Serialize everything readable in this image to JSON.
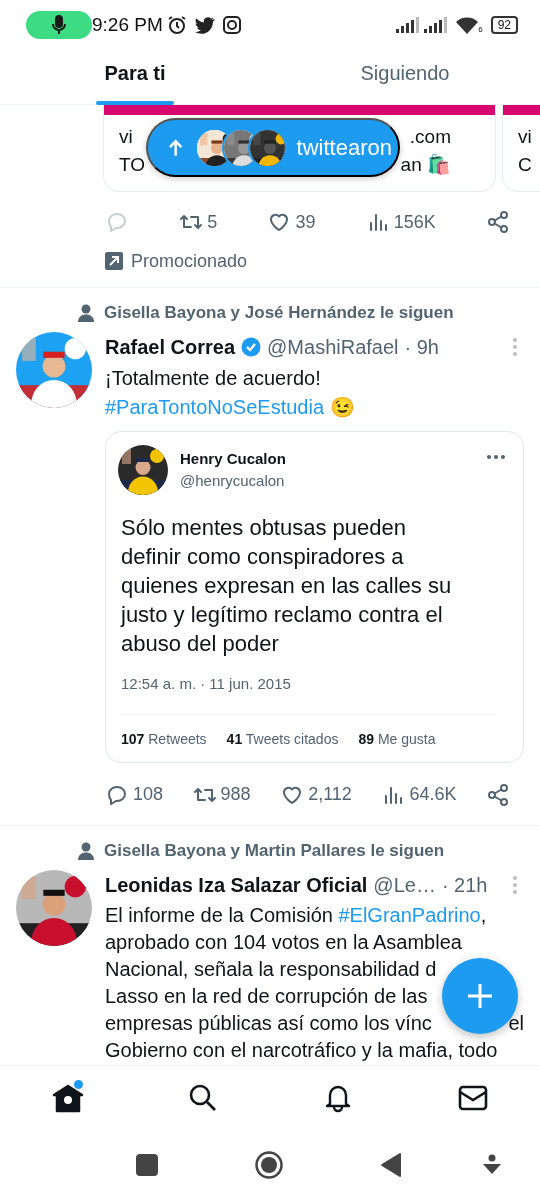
{
  "status_bar": {
    "time": "9:26 PM",
    "wifi_label": "6",
    "battery": "92"
  },
  "tabs": [
    {
      "label": "Para ti",
      "selected": true
    },
    {
      "label": "Siguiendo",
      "selected": false
    }
  ],
  "new_posts_pill": {
    "label": "twittearon",
    "avatars": [
      {
        "kind": "picture"
      },
      {
        "kind": "picture"
      },
      {
        "kind": "picture"
      }
    ]
  },
  "promo": {
    "cards": [
      {
        "lines": [
          {
            "text": "vi",
            "tail": ".com"
          },
          {
            "text": "TO",
            "tail": "an 🛍️"
          }
        ]
      },
      {
        "lines": [
          {
            "text": "vi"
          },
          {
            "text": "C"
          }
        ]
      }
    ],
    "actions": [
      {
        "kind": "reply",
        "disabled": true
      },
      {
        "kind": "retweet",
        "count": "5",
        "disabled": false
      },
      {
        "kind": "like",
        "count": "39",
        "disabled": false
      },
      {
        "kind": "views",
        "count": "156K",
        "disabled": false
      },
      {
        "kind": "share",
        "disabled": false
      }
    ],
    "label": "Promocionado"
  },
  "tweets": [
    {
      "social_context": "Gisella Bayona y José Hernández le siguen",
      "avatar": {
        "kind": "picture"
      },
      "name": "Rafael Correa",
      "verified": true,
      "handle": "@MashiRafael",
      "time": "· 9h",
      "lines": [
        {
          "segments": [
            {
              "kind": "text",
              "text": "¡Totalmente de acuerdo!"
            }
          ]
        },
        {
          "segments": [
            {
              "kind": "hashtag",
              "text": "#ParaTontoNoSeEstudia"
            },
            {
              "kind": "text",
              "text": " 😉"
            }
          ]
        }
      ],
      "quote": {
        "avatar": {
          "kind": "picture"
        },
        "name": "Henry Cucalon",
        "handle": "@henrycucalon",
        "text": "Sólo mentes obtusas pueden\ndefinir como conspiradores a\nquienes expresan en las calles su\njusto y legítimo reclamo contra el\nabuso del poder",
        "date": "12:54 a. m. · 11 jun. 2015",
        "stats": [
          "**107** Retweets",
          "**41** Tweets citados",
          "**89** Me gusta"
        ]
      },
      "actions": [
        {
          "kind": "reply",
          "count": "108",
          "disabled": false
        },
        {
          "kind": "retweet",
          "count": "988",
          "disabled": false
        },
        {
          "kind": "like",
          "count": "2,112",
          "disabled": false
        },
        {
          "kind": "views",
          "count": "64.6K",
          "disabled": false
        },
        {
          "kind": "share",
          "disabled": false
        }
      ]
    },
    {
      "social_context": "Gisella Bayona y Martin Pallares le siguen",
      "avatar": {
        "kind": "picture"
      },
      "name": "Leonidas Iza Salazar Oficial",
      "verified": false,
      "handle": "@Le…",
      "time": "· 21h",
      "lines": [
        {
          "segments": [
            {
              "kind": "text",
              "text": "El informe de la Comisión "
            },
            {
              "kind": "hashtag",
              "text": "#ElGranPadrino"
            },
            {
              "kind": "text",
              "text": ","
            }
          ]
        },
        {
          "segments": [
            {
              "kind": "text",
              "text": "aprobado con 104 votos en la Asamblea"
            }
          ]
        },
        {
          "segments": [
            {
              "kind": "text",
              "text": "Nacional, señala la responsabilidad d"
            }
          ]
        },
        {
          "segments": [
            {
              "kind": "text",
              "text": "Lasso en la red de corrupción de las"
            }
          ]
        },
        {
          "segments": [
            {
              "kind": "text",
              "text": "empresas públicas así como los vínc"
            }
          ],
          "tail": "el"
        },
        {
          "segments": [
            {
              "kind": "text",
              "text": "Gobierno con el narcotráfico y la mafia, todo"
            }
          ]
        }
      ]
    }
  ],
  "bottom_nav": [
    {
      "kind": "home",
      "selected": true,
      "dot": true
    },
    {
      "kind": "search",
      "selected": false,
      "dot": false
    },
    {
      "kind": "notifications",
      "selected": false,
      "dot": false
    },
    {
      "kind": "messages",
      "selected": false,
      "dot": false
    }
  ]
}
